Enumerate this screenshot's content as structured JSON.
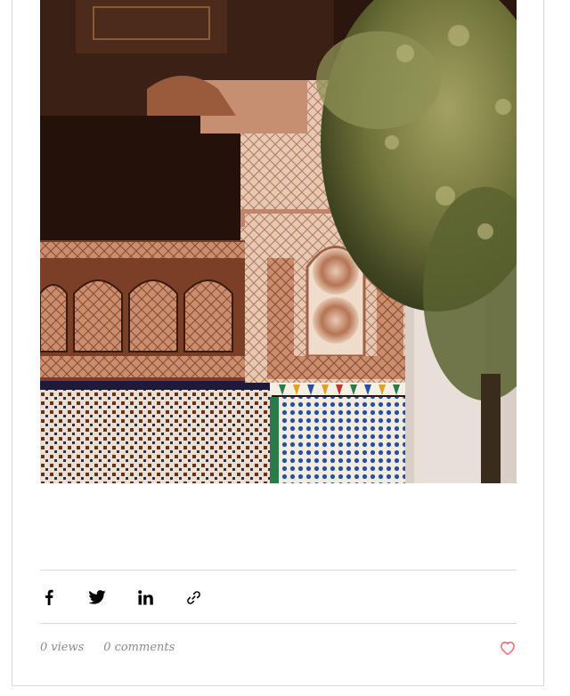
{
  "post": {
    "image": {
      "subject": "moroccan-carved-arches-and-zellige-tiles-with-tree"
    },
    "share": {
      "items": [
        {
          "icon": "facebook-icon"
        },
        {
          "icon": "twitter-icon"
        },
        {
          "icon": "linkedin-icon"
        },
        {
          "icon": "link-icon"
        }
      ]
    },
    "stats": {
      "views_count": "0",
      "views_label": "views",
      "comments_count": "0",
      "comments_label": "comments"
    },
    "like": {
      "icon": "heart-icon",
      "color": "#e8696b"
    }
  }
}
